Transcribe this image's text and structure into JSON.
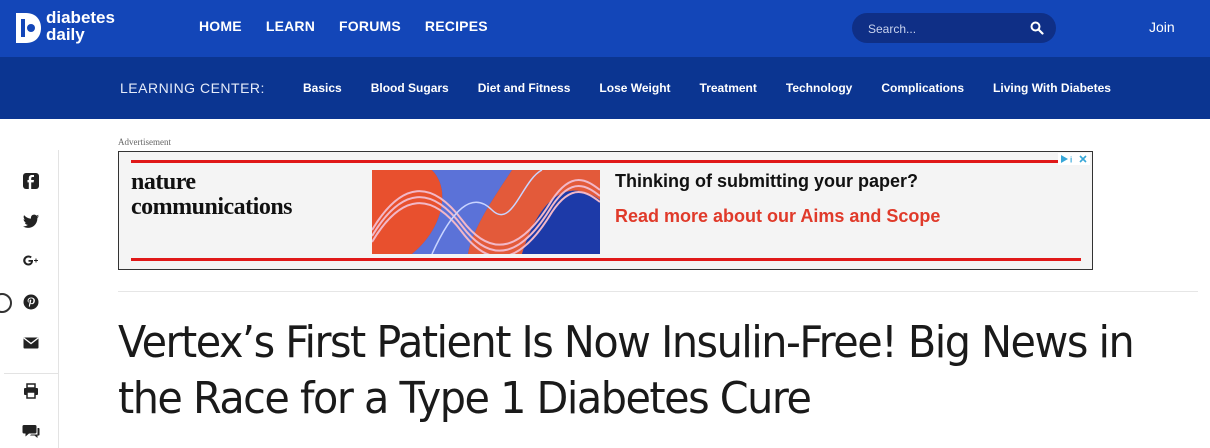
{
  "header": {
    "logo_line1": "diabetes",
    "logo_line2": "daily",
    "nav": [
      "HOME",
      "LEARN",
      "FORUMS",
      "RECIPES"
    ],
    "search_placeholder": "Search...",
    "join_label": "Join",
    "accent_color": "#1346b8"
  },
  "learning_center": {
    "label": "LEARNING CENTER:",
    "items": [
      "Basics",
      "Blood Sugars",
      "Diet and Fitness",
      "Lose Weight",
      "Treatment",
      "Technology",
      "Complications",
      "Living With Diabetes"
    ]
  },
  "share": {
    "icons": [
      "facebook-icon",
      "twitter-icon",
      "google-plus-icon",
      "pinterest-icon",
      "email-icon",
      "print-icon",
      "comment-icon"
    ]
  },
  "ad": {
    "label": "Advertisement",
    "brand_line1": "nature",
    "brand_line2": "communications",
    "headline": "Thinking of submitting your paper?",
    "cta": "Read more about our Aims and Scope",
    "cta_color": "#e03a2a"
  },
  "article": {
    "title": "Vertex’s First Patient Is Now Insulin-Free! Big News in the Race for a Type 1 Diabetes Cure"
  }
}
